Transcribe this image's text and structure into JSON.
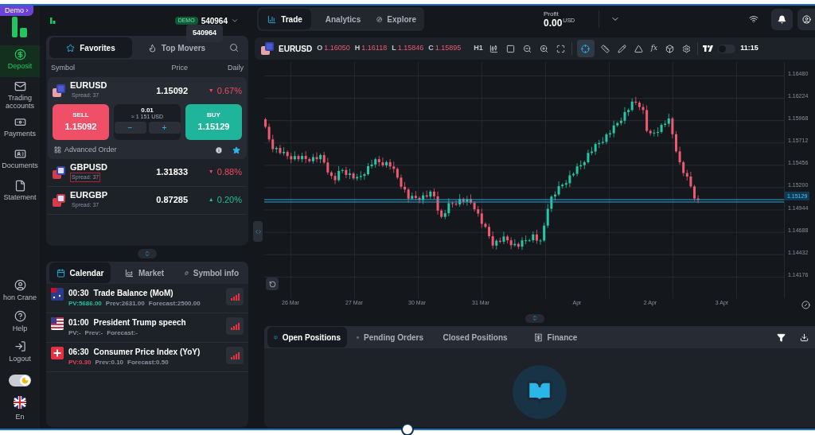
{
  "sidebar": {
    "demo_badge": "Demo ›",
    "items": [
      {
        "label": "Deposit",
        "selected": true
      },
      {
        "label": "Trading accounts",
        "selected": false
      },
      {
        "label": "Payments",
        "selected": false
      },
      {
        "label": "Documents",
        "selected": false
      },
      {
        "label": "Statement",
        "selected": false
      }
    ],
    "bottom_items": [
      {
        "label": "hon Crane"
      },
      {
        "label": "Help"
      },
      {
        "label": "Logout"
      }
    ],
    "dark_mode": true,
    "language": "En"
  },
  "account": {
    "badge": "DEMO",
    "number": "540964",
    "tooltip": "540964"
  },
  "watchlist": {
    "tabs": [
      {
        "label": "Favorites",
        "selected": true
      },
      {
        "label": "Top Movers",
        "selected": false
      }
    ],
    "columns": [
      "Symbol",
      "Price",
      "Daily"
    ],
    "symbols": [
      {
        "name": "EURUSD",
        "spread": "Spread: 37",
        "price": "1.15092",
        "change": "0.67%",
        "arrow": "▼",
        "color": "#ef4a62",
        "expanded": true,
        "highlighted": false
      },
      {
        "name": "GBPUSD",
        "spread": "Spread: 37",
        "price": "1.31833",
        "change": "0.88%",
        "arrow": "▼",
        "color": "#ef4a62",
        "expanded": false,
        "highlighted": true
      },
      {
        "name": "EURGBP",
        "spread": "Spread: 37",
        "price": "0.87285",
        "change": "0.20%",
        "arrow": "▲",
        "color": "#1fbf9a",
        "expanded": false,
        "highlighted": false
      }
    ],
    "trade": {
      "sell_label": "SELL",
      "sell_price": "1.15092",
      "volume": "0.01",
      "volume_value": "≈ 1 151 USD",
      "minus": "−",
      "plus": "+",
      "buy_label": "BUY",
      "buy_price": "1.15129",
      "advanced_order": "Advanced Order",
      "favorite": true
    }
  },
  "calendar": {
    "tabs": [
      {
        "label": "Calendar",
        "selected": true
      },
      {
        "label": "Market",
        "selected": false
      },
      {
        "label": "Symbol info",
        "selected": false
      }
    ],
    "events": [
      {
        "time": "00:30",
        "title": "Trade Balance (MoM)",
        "pv": {
          "text": "PV:5686.00",
          "color": "#1fbf9a"
        },
        "prev": "Prev:2631.00",
        "forecast": "Forecast:2500.00"
      },
      {
        "time": "01:00",
        "title": "President Trump speech",
        "pv": {
          "text": "PV:-",
          "color": "#8a919c"
        },
        "prev": "Prev:-",
        "forecast": "Forecast:-"
      },
      {
        "time": "06:30",
        "title": "Consumer Price Index (YoY)",
        "pv": {
          "text": "PV:0.30",
          "color": "#e0435a"
        },
        "prev": "Prev:0.10",
        "forecast": "Forecast:0.50"
      }
    ]
  },
  "nav_tabs": [
    {
      "label": "Trade",
      "selected": true
    },
    {
      "label": "Analytics",
      "selected": false
    },
    {
      "label": "Explore",
      "selected": false
    }
  ],
  "profit": {
    "label": "Profit",
    "value": "0.00",
    "currency": "USD"
  },
  "chart": {
    "symbol": "EURUSD",
    "ohlc": [
      {
        "key": "O",
        "value": "1.16050"
      },
      {
        "key": "H",
        "value": "1.16118"
      },
      {
        "key": "L",
        "value": "1.15846"
      },
      {
        "key": "C",
        "value": "1.15895"
      }
    ],
    "timeframe": "H1",
    "indicator": "fx",
    "tradingview_on": false,
    "time": "11:15",
    "price_ticks": [
      "1.16480",
      "1.16224",
      "1.15968",
      "1.15712",
      "1.15456",
      "1.15200",
      "1.14944",
      "1.14688",
      "1.14432",
      "1.14176"
    ],
    "current_price": "1.15129",
    "date_ticks": [
      "26 Mar",
      "27 Mar",
      "30 Mar",
      "31 Mar",
      "Apr",
      "2 Apr",
      "3 Apr"
    ]
  },
  "positions": {
    "tabs": [
      {
        "label": "Open Positions",
        "selected": true
      },
      {
        "label": "Pending Orders",
        "selected": false
      },
      {
        "label": "Closed Positions",
        "selected": false
      },
      {
        "label": "Finance",
        "selected": false
      }
    ]
  }
}
